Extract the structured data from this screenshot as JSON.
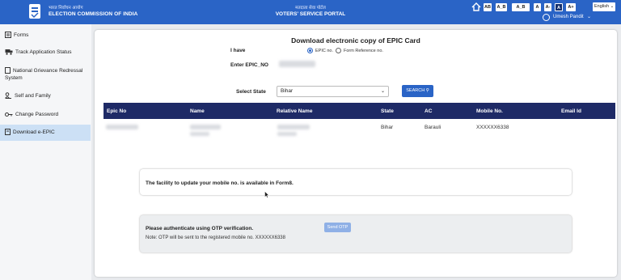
{
  "header": {
    "eci_hindi": "भारत निर्वाचन आयोग",
    "eci_english": "ELECTION COMMISSION OF INDIA",
    "portal_hindi": "मतदाता सेवा पोर्टल",
    "portal_english": "VOTERS' SERVICE PORTAL",
    "font_buttons": [
      "AB",
      "A_B",
      "A_B",
      "A",
      "A-",
      "A",
      "A+"
    ],
    "language": "English",
    "user_name": "Umesh Pandit"
  },
  "sidebar": {
    "items": [
      {
        "label": "Forms",
        "icon": "forms-icon"
      },
      {
        "label": "Track Application Status",
        "icon": "truck-icon"
      },
      {
        "label": "National Grievance Redressal System",
        "icon": "document-icon"
      },
      {
        "label": "Self and Family",
        "icon": "people-icon"
      },
      {
        "label": "Change Password",
        "icon": "key-icon"
      },
      {
        "label": "Download e-EPIC",
        "icon": "download-icon",
        "active": true
      }
    ]
  },
  "form": {
    "title": "Download electronic copy of EPIC Card",
    "i_have_label": "I have",
    "radio_epic": "EPIC no.",
    "radio_form_ref": "Form Reference no.",
    "enter_epic_label": "Enter EPIC_NO",
    "select_state_label": "Select State",
    "state_value": "Bihar",
    "search_label": "SEARCH"
  },
  "table": {
    "headers": [
      "Epic No",
      "Name",
      "Relative Name",
      "State",
      "AC",
      "Mobile No.",
      "Email Id"
    ],
    "row": {
      "state": "Bihar",
      "ac": "Barauli",
      "mobile": "XXXXXX6338"
    }
  },
  "notices": {
    "form8": "The facility to update your mobile no. is available in Form8.",
    "otp_title": "Please authenticate using OTP verification.",
    "otp_note": "Note: OTP will be sent to the registered mobile no. XXXXXX6338",
    "send_otp": "Send OTP"
  },
  "colors": {
    "header_blue": "#2a64c6",
    "table_header": "#1e2a66",
    "active_side": "#cce0f5"
  }
}
